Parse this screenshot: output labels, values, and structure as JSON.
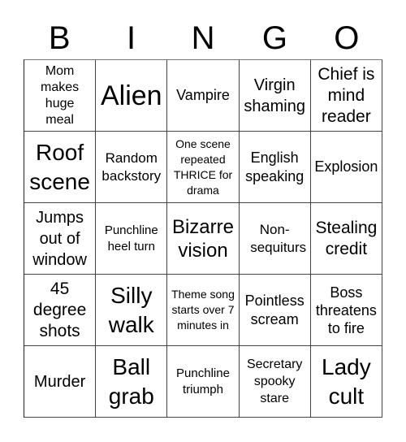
{
  "header": [
    "B",
    "I",
    "N",
    "G",
    "O"
  ],
  "cells": [
    [
      "Mom makes huge meal",
      "Alien",
      "Vampire",
      "Virgin shaming",
      "Chief is mind reader"
    ],
    [
      "Roof scene",
      "Random backstory",
      "One scene repeated THRICE for drama",
      "English speaking",
      "Explosion"
    ],
    [
      "Jumps out of window",
      "Punchline heel turn",
      "Bizarre vision",
      "Non-sequiturs",
      "Stealing credit"
    ],
    [
      "45 degree shots",
      "Silly walk",
      "Theme song starts over 7 minutes in",
      "Pointless scream",
      "Boss threatens to fire"
    ],
    [
      "Murder",
      "Ball grab",
      "Punchline triumph",
      "Secretary spooky stare",
      "Lady cult"
    ]
  ]
}
